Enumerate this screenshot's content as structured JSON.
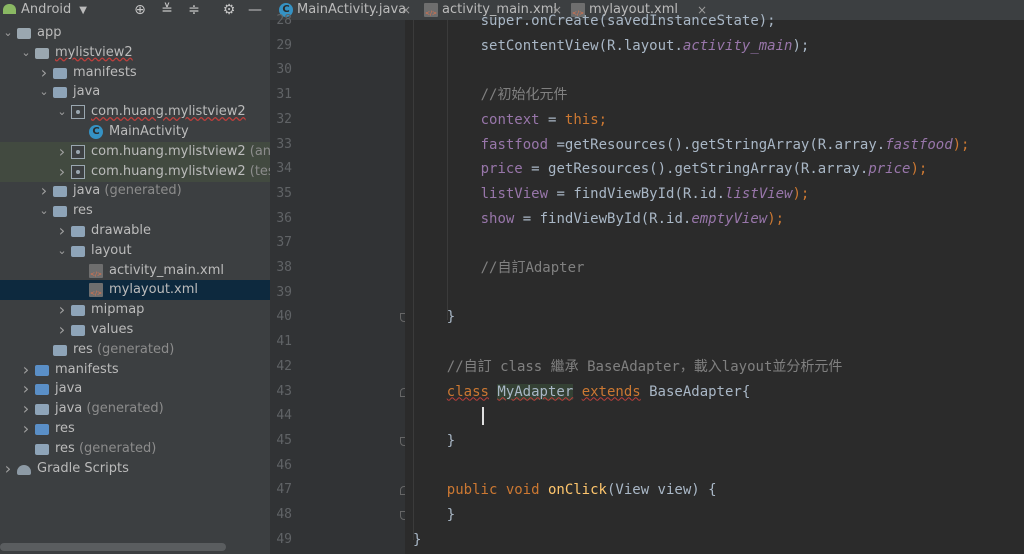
{
  "project_panel": {
    "view_mode": "Android",
    "toolbar_icons": [
      "locate-icon",
      "expand-all-icon",
      "collapse-all-icon",
      "gear-icon",
      "hide-icon"
    ],
    "tree": [
      {
        "label": "app",
        "extra": "",
        "indent": 0,
        "arrow": "down",
        "icon": "module"
      },
      {
        "label": "mylistview2",
        "extra": "",
        "indent": 1,
        "arrow": "down",
        "icon": "module",
        "wavy": true
      },
      {
        "label": "manifests",
        "extra": "",
        "indent": 2,
        "arrow": "right",
        "icon": "folder"
      },
      {
        "label": "java",
        "extra": "",
        "indent": 2,
        "arrow": "down",
        "icon": "folder"
      },
      {
        "label": "com.huang.mylistview2",
        "extra": "",
        "indent": 3,
        "arrow": "down",
        "icon": "package",
        "wavy": true
      },
      {
        "label": "MainActivity",
        "extra": "",
        "indent": 4,
        "arrow": "",
        "icon": "class"
      },
      {
        "label": "com.huang.mylistview2",
        "extra": "(andr",
        "indent": 3,
        "arrow": "right",
        "icon": "package",
        "row_style": "green"
      },
      {
        "label": "com.huang.mylistview2",
        "extra": "(test)",
        "indent": 3,
        "arrow": "right",
        "icon": "package",
        "row_style": "green"
      },
      {
        "label": "java",
        "extra": "(generated)",
        "indent": 2,
        "arrow": "right",
        "icon": "folder-gen"
      },
      {
        "label": "res",
        "extra": "",
        "indent": 2,
        "arrow": "down",
        "icon": "folder"
      },
      {
        "label": "drawable",
        "extra": "",
        "indent": 3,
        "arrow": "right",
        "icon": "folder"
      },
      {
        "label": "layout",
        "extra": "",
        "indent": 3,
        "arrow": "down",
        "icon": "folder"
      },
      {
        "label": "activity_main.xml",
        "extra": "",
        "indent": 4,
        "arrow": "",
        "icon": "xml"
      },
      {
        "label": "mylayout.xml",
        "extra": "",
        "indent": 4,
        "arrow": "",
        "icon": "xml",
        "row_style": "selected"
      },
      {
        "label": "mipmap",
        "extra": "",
        "indent": 3,
        "arrow": "right",
        "icon": "folder"
      },
      {
        "label": "values",
        "extra": "",
        "indent": 3,
        "arrow": "right",
        "icon": "folder"
      },
      {
        "label": "res",
        "extra": "(generated)",
        "indent": 2,
        "arrow": "",
        "icon": "folder-gen"
      },
      {
        "label": "manifests",
        "extra": "",
        "indent": 1,
        "arrow": "right",
        "icon": "folder-blue"
      },
      {
        "label": "java",
        "extra": "",
        "indent": 1,
        "arrow": "right",
        "icon": "folder-blue"
      },
      {
        "label": "java",
        "extra": "(generated)",
        "indent": 1,
        "arrow": "right",
        "icon": "folder-gen"
      },
      {
        "label": "res",
        "extra": "",
        "indent": 1,
        "arrow": "right",
        "icon": "folder-blue"
      },
      {
        "label": "res",
        "extra": "(generated)",
        "indent": 1,
        "arrow": "",
        "icon": "folder-gen"
      },
      {
        "label": "Gradle Scripts",
        "extra": "",
        "indent": 0,
        "arrow": "right",
        "icon": "gradle"
      }
    ]
  },
  "tabs": [
    {
      "label": "MainActivity.java",
      "icon": "class-icon",
      "active": true
    },
    {
      "label": "activity_main.xml",
      "icon": "xml-file-icon",
      "active": false
    },
    {
      "label": "mylayout.xml",
      "icon": "xml-file-icon",
      "active": false
    }
  ],
  "editor": {
    "first_line_number": 28,
    "current_line": 44,
    "lines": [
      {
        "n": 28,
        "indent": 2,
        "tokens": [
          {
            "t": "super.onCreate(savedInstanceState);",
            "c": ""
          }
        ]
      },
      {
        "n": 29,
        "indent": 2,
        "tokens": [
          {
            "t": "setContentView(R.layout.",
            "c": ""
          },
          {
            "t": "activity_main",
            "c": "fi"
          },
          {
            "t": ");",
            "c": ""
          }
        ]
      },
      {
        "n": 30,
        "indent": 0,
        "tokens": []
      },
      {
        "n": 31,
        "indent": 2,
        "tokens": [
          {
            "t": "//初始化元件",
            "c": "cm"
          }
        ]
      },
      {
        "n": 32,
        "indent": 2,
        "tokens": [
          {
            "t": "context",
            "c": "fld"
          },
          {
            "t": " = ",
            "c": ""
          },
          {
            "t": "this",
            "c": "kw"
          },
          {
            "t": ";",
            "c": "kw"
          }
        ]
      },
      {
        "n": 33,
        "indent": 2,
        "tokens": [
          {
            "t": "fastfood",
            "c": "fld"
          },
          {
            "t": " =getResources().getStringArray(R.array.",
            "c": ""
          },
          {
            "t": "fastfood",
            "c": "fi"
          },
          {
            "t": ");",
            "c": "kw"
          }
        ]
      },
      {
        "n": 34,
        "indent": 2,
        "tokens": [
          {
            "t": "price",
            "c": "fld"
          },
          {
            "t": " = getResources().getStringArray(R.array.",
            "c": ""
          },
          {
            "t": "price",
            "c": "fi"
          },
          {
            "t": ");",
            "c": "kw"
          }
        ]
      },
      {
        "n": 35,
        "indent": 2,
        "tokens": [
          {
            "t": "listView",
            "c": "fld"
          },
          {
            "t": " = findViewById(R.id.",
            "c": ""
          },
          {
            "t": "listView",
            "c": "fi"
          },
          {
            "t": ");",
            "c": "kw"
          }
        ]
      },
      {
        "n": 36,
        "indent": 2,
        "tokens": [
          {
            "t": "show",
            "c": "fld"
          },
          {
            "t": " = findViewById(R.id.",
            "c": ""
          },
          {
            "t": "emptyView",
            "c": "fi"
          },
          {
            "t": ");",
            "c": "kw"
          }
        ]
      },
      {
        "n": 37,
        "indent": 0,
        "tokens": []
      },
      {
        "n": 38,
        "indent": 2,
        "tokens": [
          {
            "t": "//自訂Adapter",
            "c": "cm"
          }
        ]
      },
      {
        "n": 39,
        "indent": 0,
        "tokens": []
      },
      {
        "n": 40,
        "indent": 1,
        "tokens": [
          {
            "t": "}",
            "c": ""
          }
        ]
      },
      {
        "n": 41,
        "indent": 0,
        "tokens": []
      },
      {
        "n": 42,
        "indent": 1,
        "tokens": [
          {
            "t": "//自訂 class 繼承 BaseAdapter，載入layout並分析元件",
            "c": "cm"
          }
        ]
      },
      {
        "n": 43,
        "indent": 1,
        "tokens": [
          {
            "t": "class",
            "c": "kw wavy"
          },
          {
            "t": " ",
            "c": ""
          },
          {
            "t": "MyAdapter",
            "c": "hl wavy"
          },
          {
            "t": " ",
            "c": ""
          },
          {
            "t": "extends",
            "c": "kw wavy"
          },
          {
            "t": " BaseAdapter{",
            "c": ""
          }
        ]
      },
      {
        "n": 44,
        "indent": 0,
        "tokens": []
      },
      {
        "n": 45,
        "indent": 1,
        "tokens": [
          {
            "t": "}",
            "c": ""
          }
        ]
      },
      {
        "n": 46,
        "indent": 0,
        "tokens": []
      },
      {
        "n": 47,
        "indent": 1,
        "tokens": [
          {
            "t": "public",
            "c": "kw"
          },
          {
            "t": " ",
            "c": ""
          },
          {
            "t": "void",
            "c": "kw"
          },
          {
            "t": " ",
            "c": ""
          },
          {
            "t": "onClick",
            "c": "fn"
          },
          {
            "t": "(View view) {",
            "c": ""
          }
        ]
      },
      {
        "n": 48,
        "indent": 1,
        "tokens": [
          {
            "t": "}",
            "c": ""
          }
        ]
      },
      {
        "n": 49,
        "indent": 0,
        "tokens": [
          {
            "t": "}",
            "c": ""
          }
        ]
      }
    ]
  }
}
